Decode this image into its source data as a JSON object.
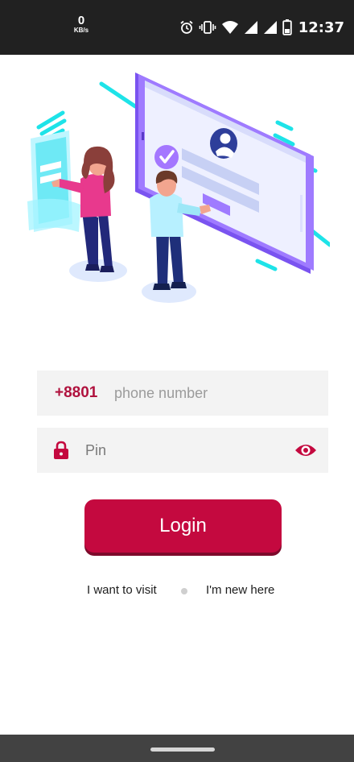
{
  "status_bar": {
    "net_speed_value": "0",
    "net_speed_unit": "KB/s",
    "time": "12:37",
    "icons": [
      "alarm-icon",
      "vibrate-icon",
      "wifi-icon",
      "signal-icon",
      "signal-icon",
      "battery-icon"
    ]
  },
  "illustration": {
    "name": "login-illustration"
  },
  "login_form": {
    "country_code": "+8801",
    "phone_placeholder": "phone number",
    "phone_value": "",
    "pin_placeholder": "Pin",
    "pin_value": "",
    "login_label": "Login"
  },
  "links": {
    "visit_label": "I want to visit",
    "new_label": "I'm new here"
  },
  "colors": {
    "accent": "#c4093f",
    "field_background": "#f3f3f3",
    "status_bar": "#212121",
    "nav_bar": "#424242"
  }
}
